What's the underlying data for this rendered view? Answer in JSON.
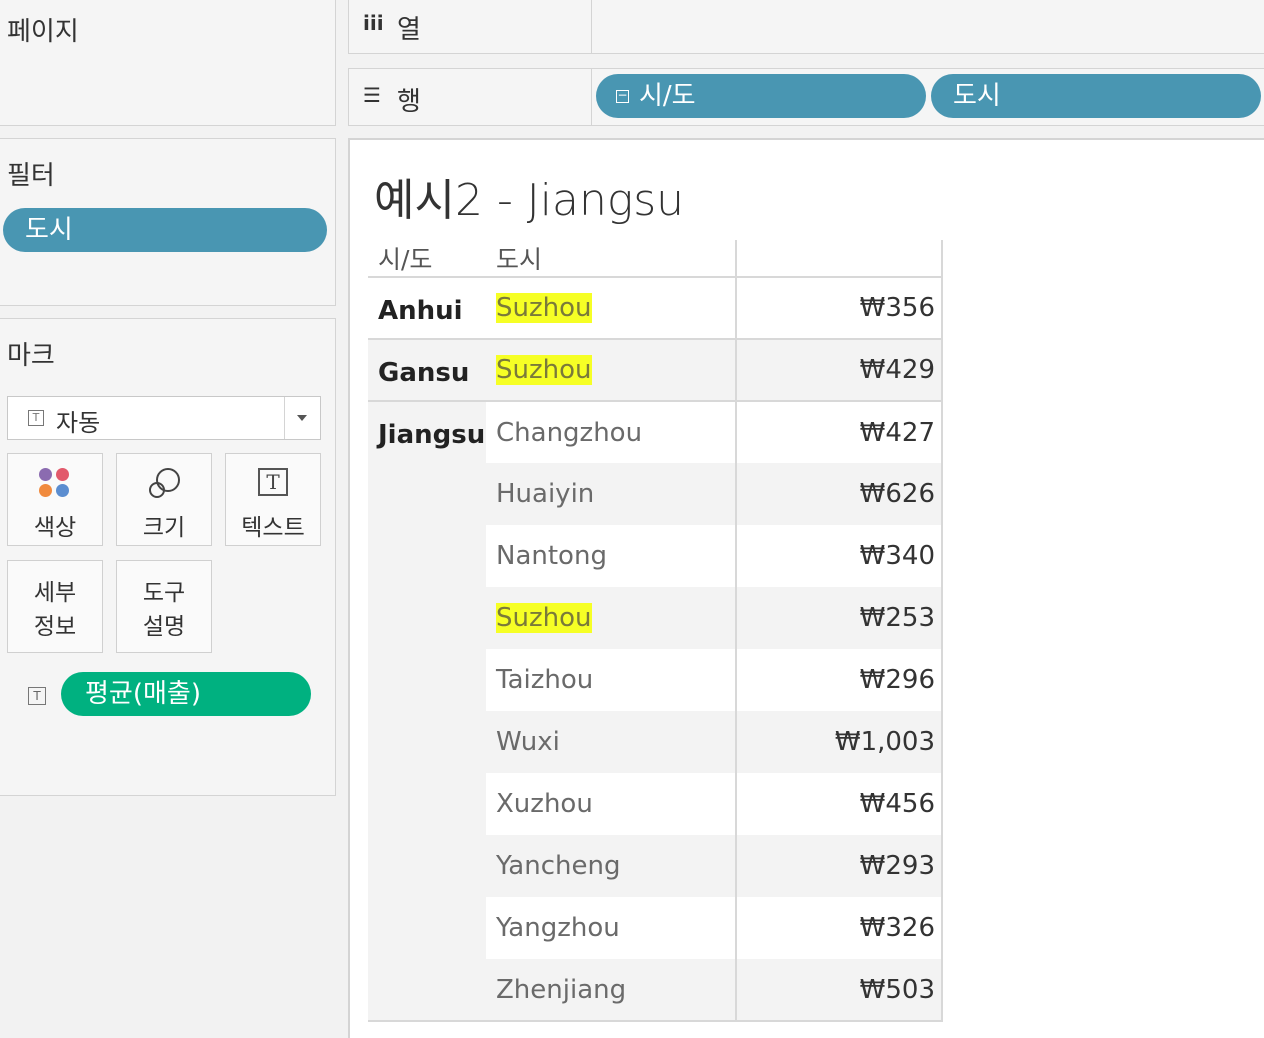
{
  "left": {
    "pages": {
      "title": "페이지"
    },
    "filters": {
      "title": "필터",
      "pill": "도시"
    },
    "marks": {
      "title": "마크",
      "mark_type": "자동",
      "buttons": {
        "color": "색상",
        "size": "크기",
        "text": "텍스트",
        "detail_1": "세부",
        "detail_2": "정보",
        "tooltip_1": "도구",
        "tooltip_2": "설명"
      },
      "field_pill": "평균(매출)"
    }
  },
  "shelves": {
    "columns": {
      "icon": "iii",
      "label": "열"
    },
    "rows": {
      "icon": "☰",
      "label": "행",
      "pills": [
        "시/도",
        "도시"
      ]
    }
  },
  "viz": {
    "title": "예시2 - Jiangsu",
    "headers": [
      "시/도",
      "도시"
    ],
    "rows": [
      {
        "province": "Anhui",
        "city": "Suzhou",
        "value": "₩356",
        "highlight": true
      },
      {
        "province": "Gansu",
        "city": "Suzhou",
        "value": "₩429",
        "highlight": true
      },
      {
        "province": "Jiangsu",
        "city": "Changzhou",
        "value": "₩427",
        "highlight": false
      },
      {
        "province": "",
        "city": "Huaiyin",
        "value": "₩626",
        "highlight": false
      },
      {
        "province": "",
        "city": "Nantong",
        "value": "₩340",
        "highlight": false
      },
      {
        "province": "",
        "city": "Suzhou",
        "value": "₩253",
        "highlight": true
      },
      {
        "province": "",
        "city": "Taizhou",
        "value": "₩296",
        "highlight": false
      },
      {
        "province": "",
        "city": "Wuxi",
        "value": "₩1,003",
        "highlight": false
      },
      {
        "province": "",
        "city": "Xuzhou",
        "value": "₩456",
        "highlight": false
      },
      {
        "province": "",
        "city": "Yancheng",
        "value": "₩293",
        "highlight": false
      },
      {
        "province": "",
        "city": "Yangzhou",
        "value": "₩326",
        "highlight": false
      },
      {
        "province": "",
        "city": "Zhenjiang",
        "value": "₩503",
        "highlight": false
      }
    ]
  },
  "colors": {
    "dimension_pill": "#4996b2",
    "measure_pill": "#00b180",
    "highlight": "#f6ff25"
  }
}
